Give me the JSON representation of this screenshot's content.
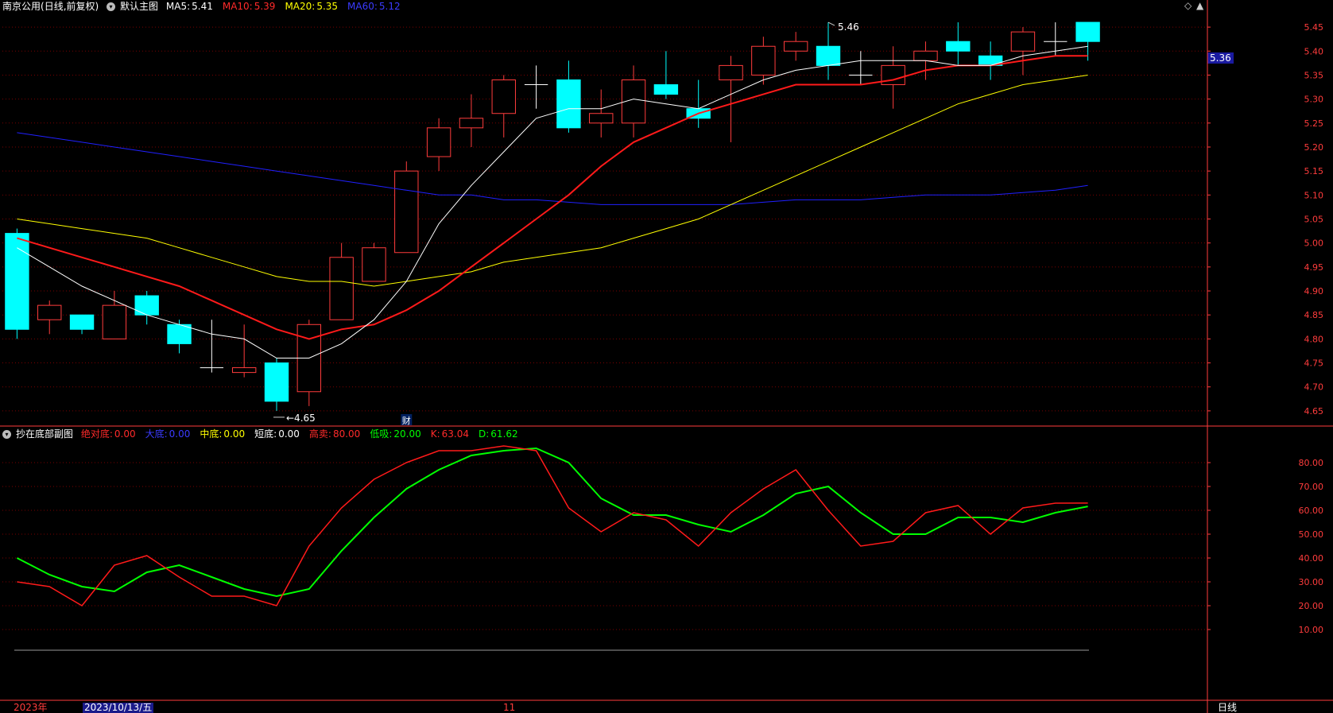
{
  "header_main": {
    "stock": "南京公用",
    "mode": "(日线,前复权)",
    "indicator": "默认主图",
    "ma": [
      {
        "label": "MA5:",
        "value": "5.41",
        "color": "#ffffff"
      },
      {
        "label": "MA10:",
        "value": "5.39",
        "color": "#ff2a2a"
      },
      {
        "label": "MA20:",
        "value": "5.35",
        "color": "#ffff00"
      },
      {
        "label": "MA60:",
        "value": "5.12",
        "color": "#3b3bff"
      }
    ]
  },
  "header_sub": {
    "title": "抄在底部副图",
    "items": [
      {
        "label": "绝对底:",
        "value": "0.00",
        "color": "#ff2a2a"
      },
      {
        "label": "大底:",
        "value": "0.00",
        "color": "#3b3bff"
      },
      {
        "label": "中底:",
        "value": "0.00",
        "color": "#ffff00"
      },
      {
        "label": "短底:",
        "value": "0.00",
        "color": "#ffffff"
      },
      {
        "label": "高卖:",
        "value": "80.00",
        "color": "#ff2a2a"
      },
      {
        "label": "低吸:",
        "value": "20.00",
        "color": "#00ff00"
      },
      {
        "label": "K:",
        "value": "63.04",
        "color": "#ff2a2a"
      },
      {
        "label": "D:",
        "value": "61.62",
        "color": "#00ff00"
      }
    ]
  },
  "corner_icons": [
    "diamond-icon",
    "scroll-up-icon"
  ],
  "current_price": "5.36",
  "annotations": {
    "high_label": "5.46",
    "low_label": "4.65",
    "fin_marker": "财"
  },
  "footer": {
    "year": "2023年",
    "date": "2023/10/13/五",
    "month": "11",
    "period": "日线"
  },
  "colors": {
    "up": "#ff3c3c",
    "down": "#00ffff",
    "grid": "#7a0000",
    "axis": "#ff3c3c",
    "ma5": "#ffffff",
    "ma10": "#ff1a1a",
    "ma20": "#ffff00",
    "ma60": "#2020ff",
    "k": "#ff1a1a",
    "d": "#00ff00"
  },
  "chart_data": [
    {
      "type": "candlestick",
      "ylim": [
        4.62,
        5.48
      ],
      "yticks": [
        4.65,
        4.7,
        4.75,
        4.8,
        4.85,
        4.9,
        4.95,
        5.0,
        5.05,
        5.1,
        5.15,
        5.2,
        5.25,
        5.3,
        5.35,
        5.4,
        5.45
      ],
      "candles": [
        {
          "o": 5.02,
          "h": 5.03,
          "l": 4.8,
          "c": 4.82
        },
        {
          "o": 4.84,
          "h": 4.88,
          "l": 4.81,
          "c": 4.87
        },
        {
          "o": 4.85,
          "h": 4.85,
          "l": 4.81,
          "c": 4.82
        },
        {
          "o": 4.8,
          "h": 4.9,
          "l": 4.8,
          "c": 4.87
        },
        {
          "o": 4.89,
          "h": 4.9,
          "l": 4.83,
          "c": 4.85
        },
        {
          "o": 4.83,
          "h": 4.84,
          "l": 4.77,
          "c": 4.79
        },
        {
          "o": 4.74,
          "h": 4.84,
          "l": 4.73,
          "c": 4.74
        },
        {
          "o": 4.73,
          "h": 4.83,
          "l": 4.72,
          "c": 4.74
        },
        {
          "o": 4.75,
          "h": 4.76,
          "l": 4.65,
          "c": 4.67
        },
        {
          "o": 4.69,
          "h": 4.84,
          "l": 4.66,
          "c": 4.83
        },
        {
          "o": 4.84,
          "h": 5.0,
          "l": 4.84,
          "c": 4.97
        },
        {
          "o": 4.92,
          "h": 5.0,
          "l": 4.92,
          "c": 4.99
        },
        {
          "o": 4.98,
          "h": 5.17,
          "l": 4.98,
          "c": 5.15
        },
        {
          "o": 5.18,
          "h": 5.26,
          "l": 5.15,
          "c": 5.24
        },
        {
          "o": 5.24,
          "h": 5.31,
          "l": 5.2,
          "c": 5.26
        },
        {
          "o": 5.27,
          "h": 5.35,
          "l": 5.22,
          "c": 5.34
        },
        {
          "o": 5.33,
          "h": 5.37,
          "l": 5.28,
          "c": 5.33
        },
        {
          "o": 5.34,
          "h": 5.38,
          "l": 5.23,
          "c": 5.24
        },
        {
          "o": 5.25,
          "h": 5.32,
          "l": 5.22,
          "c": 5.27
        },
        {
          "o": 5.25,
          "h": 5.37,
          "l": 5.22,
          "c": 5.34
        },
        {
          "o": 5.33,
          "h": 5.4,
          "l": 5.3,
          "c": 5.31
        },
        {
          "o": 5.28,
          "h": 5.34,
          "l": 5.24,
          "c": 5.26
        },
        {
          "o": 5.34,
          "h": 5.39,
          "l": 5.21,
          "c": 5.37
        },
        {
          "o": 5.35,
          "h": 5.43,
          "l": 5.33,
          "c": 5.41
        },
        {
          "o": 5.4,
          "h": 5.44,
          "l": 5.38,
          "c": 5.42
        },
        {
          "o": 5.41,
          "h": 5.46,
          "l": 5.34,
          "c": 5.37
        },
        {
          "o": 5.35,
          "h": 5.4,
          "l": 5.33,
          "c": 5.35
        },
        {
          "o": 5.33,
          "h": 5.41,
          "l": 5.28,
          "c": 5.37
        },
        {
          "o": 5.38,
          "h": 5.42,
          "l": 5.34,
          "c": 5.4
        },
        {
          "o": 5.42,
          "h": 5.46,
          "l": 5.37,
          "c": 5.4
        },
        {
          "o": 5.39,
          "h": 5.42,
          "l": 5.34,
          "c": 5.37
        },
        {
          "o": 5.4,
          "h": 5.45,
          "l": 5.35,
          "c": 5.44
        },
        {
          "o": 5.42,
          "h": 5.46,
          "l": 5.39,
          "c": 5.42
        },
        {
          "o": 5.46,
          "h": 5.46,
          "l": 5.38,
          "c": 5.42
        }
      ],
      "ma5": [
        4.99,
        4.95,
        4.91,
        4.88,
        4.85,
        4.83,
        4.81,
        4.8,
        4.76,
        4.76,
        4.79,
        4.84,
        4.92,
        5.04,
        5.12,
        5.19,
        5.26,
        5.28,
        5.28,
        5.3,
        5.29,
        5.28,
        5.31,
        5.34,
        5.36,
        5.37,
        5.38,
        5.38,
        5.38,
        5.37,
        5.37,
        5.39,
        5.4,
        5.41
      ],
      "ma10": [
        5.01,
        4.99,
        4.97,
        4.95,
        4.93,
        4.91,
        4.88,
        4.85,
        4.82,
        4.8,
        4.82,
        4.83,
        4.86,
        4.9,
        4.95,
        5.0,
        5.05,
        5.1,
        5.16,
        5.21,
        5.24,
        5.27,
        5.29,
        5.31,
        5.33,
        5.33,
        5.33,
        5.34,
        5.36,
        5.37,
        5.37,
        5.38,
        5.39,
        5.39
      ],
      "ma20": [
        5.05,
        5.04,
        5.03,
        5.02,
        5.01,
        4.99,
        4.97,
        4.95,
        4.93,
        4.92,
        4.92,
        4.91,
        4.92,
        4.93,
        4.94,
        4.96,
        4.97,
        4.98,
        4.99,
        5.01,
        5.03,
        5.05,
        5.08,
        5.11,
        5.14,
        5.17,
        5.2,
        5.23,
        5.26,
        5.29,
        5.31,
        5.33,
        5.34,
        5.35
      ],
      "ma60": [
        5.23,
        5.22,
        5.21,
        5.2,
        5.19,
        5.18,
        5.17,
        5.16,
        5.15,
        5.14,
        5.13,
        5.12,
        5.11,
        5.1,
        5.1,
        5.09,
        5.09,
        5.085,
        5.08,
        5.08,
        5.08,
        5.08,
        5.08,
        5.085,
        5.09,
        5.09,
        5.09,
        5.095,
        5.1,
        5.1,
        5.1,
        5.105,
        5.11,
        5.12
      ]
    },
    {
      "type": "line",
      "ylim": [
        0,
        90
      ],
      "yticks": [
        10.0,
        20.0,
        30.0,
        40.0,
        50.0,
        60.0,
        70.0,
        80.0
      ],
      "series": [
        {
          "name": "K",
          "values": [
            30,
            28,
            20,
            37,
            41,
            32,
            24,
            24,
            20,
            45,
            61,
            73,
            80,
            85,
            85,
            87,
            85,
            61,
            51,
            59,
            56,
            45,
            59,
            69,
            77,
            60,
            45,
            47,
            59,
            62,
            50,
            61,
            63,
            63.04
          ]
        },
        {
          "name": "D",
          "values": [
            40,
            33,
            28,
            26,
            34,
            37,
            32,
            27,
            24,
            27,
            43,
            57,
            69,
            77,
            83,
            85,
            86,
            80,
            65,
            58,
            58,
            54,
            51,
            58,
            67,
            70,
            59,
            50,
            50,
            57,
            57,
            55,
            59,
            61.62
          ]
        }
      ]
    }
  ]
}
